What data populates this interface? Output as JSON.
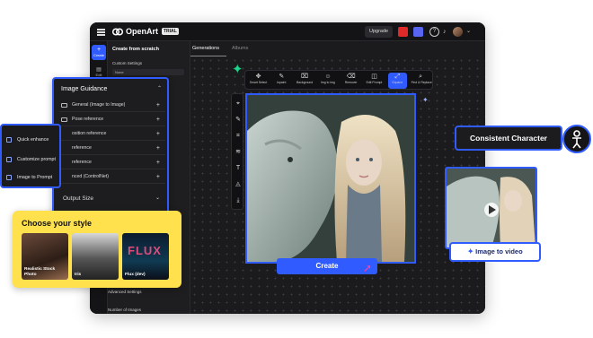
{
  "app": {
    "name": "OpenArt",
    "badge": "TRIAL",
    "upgrade_label": "Upgrade"
  },
  "strip": {
    "create_label": "Create",
    "edit_label": "Edit"
  },
  "settings": {
    "title": "Create from scratch",
    "custom_settings_label": "Custom Settings",
    "select_value": "None"
  },
  "tabs": [
    "Generations",
    "Albums"
  ],
  "toolbar": [
    {
      "icon": "✥",
      "label": "Smart Select"
    },
    {
      "icon": "✎",
      "label": "Inpaint"
    },
    {
      "icon": "⌧",
      "label": "Background"
    },
    {
      "icon": "☺",
      "label": "Img to img"
    },
    {
      "icon": "⌫",
      "label": "Remover"
    },
    {
      "icon": "◫",
      "label": "Edit Prompt"
    },
    {
      "icon": "⤢",
      "label": "Expand"
    },
    {
      "icon": "⌕",
      "label": "Find & Replace"
    }
  ],
  "guidance": {
    "title": "Image Guidance",
    "rows": [
      "General (Image to Image)",
      "Pose reference",
      "osition reference",
      "reference",
      "reference",
      "nced (ControlNet)"
    ],
    "output_size": "Output Size"
  },
  "quick": {
    "items": [
      "Quick enhance",
      "Customize prompt",
      "Image to Prompt"
    ]
  },
  "style": {
    "title": "Choose your style",
    "cards": [
      {
        "label": "Realistic Stock Photo"
      },
      {
        "label": "Iris"
      },
      {
        "label": "Flux (dev)",
        "overlay": "FLUX"
      }
    ]
  },
  "settings_bottom": {
    "advanced": "Advanced Settings",
    "number_images": "Number of Images"
  },
  "create_label": "Create",
  "features": {
    "consistent": "Consistent Character",
    "image_to_video": "Image to video"
  },
  "colors": {
    "accent": "#2f5bff",
    "style_bg": "#ffe14d",
    "spark": "#19d48b"
  }
}
